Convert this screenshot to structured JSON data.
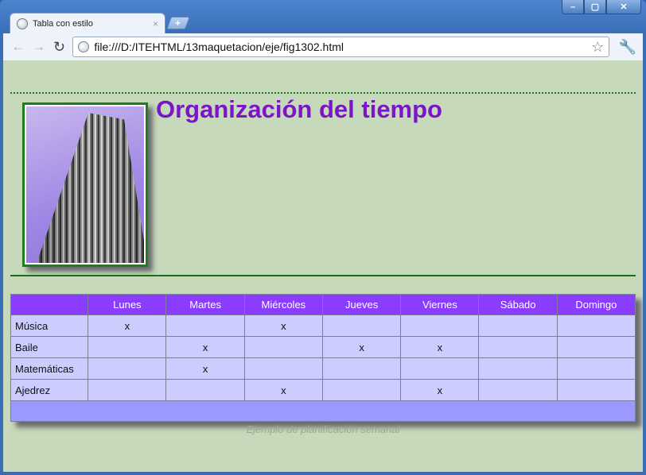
{
  "window": {
    "controls": [
      "–",
      "▢",
      "✕"
    ]
  },
  "tab": {
    "title": "Tabla con estilo",
    "close": "×",
    "new_tab": "+"
  },
  "toolbar": {
    "back": "←",
    "forward": "→",
    "reload": "↻",
    "url": "file:///D:/ITEHTML/13maquetacion/eje/fig1302.html",
    "star": "☆",
    "wrench": "🔧"
  },
  "page": {
    "title": "Organización del tiempo",
    "caption": "Ejemplo de planificación semanal",
    "table": {
      "corner": "",
      "days": [
        "Lunes",
        "Martes",
        "Miércoles",
        "Jueves",
        "Viernes",
        "Sábado",
        "Domingo"
      ],
      "rows": [
        {
          "label": "Música",
          "cells": [
            "x",
            "",
            "x",
            "",
            "",
            "",
            ""
          ]
        },
        {
          "label": "Baile",
          "cells": [
            "",
            "x",
            "",
            "x",
            "x",
            "",
            ""
          ]
        },
        {
          "label": "Matemáticas",
          "cells": [
            "",
            "x",
            "",
            "",
            "",
            "",
            ""
          ]
        },
        {
          "label": "Ajedrez",
          "cells": [
            "",
            "",
            "x",
            "",
            "x",
            "",
            ""
          ]
        }
      ]
    },
    "colors": {
      "background": "#c6d9ba",
      "title": "#7a16c8",
      "header": "#8a3cff",
      "cell": "#ccccff",
      "footer": "#9999ff",
      "rules": "#1a6e1a"
    }
  }
}
